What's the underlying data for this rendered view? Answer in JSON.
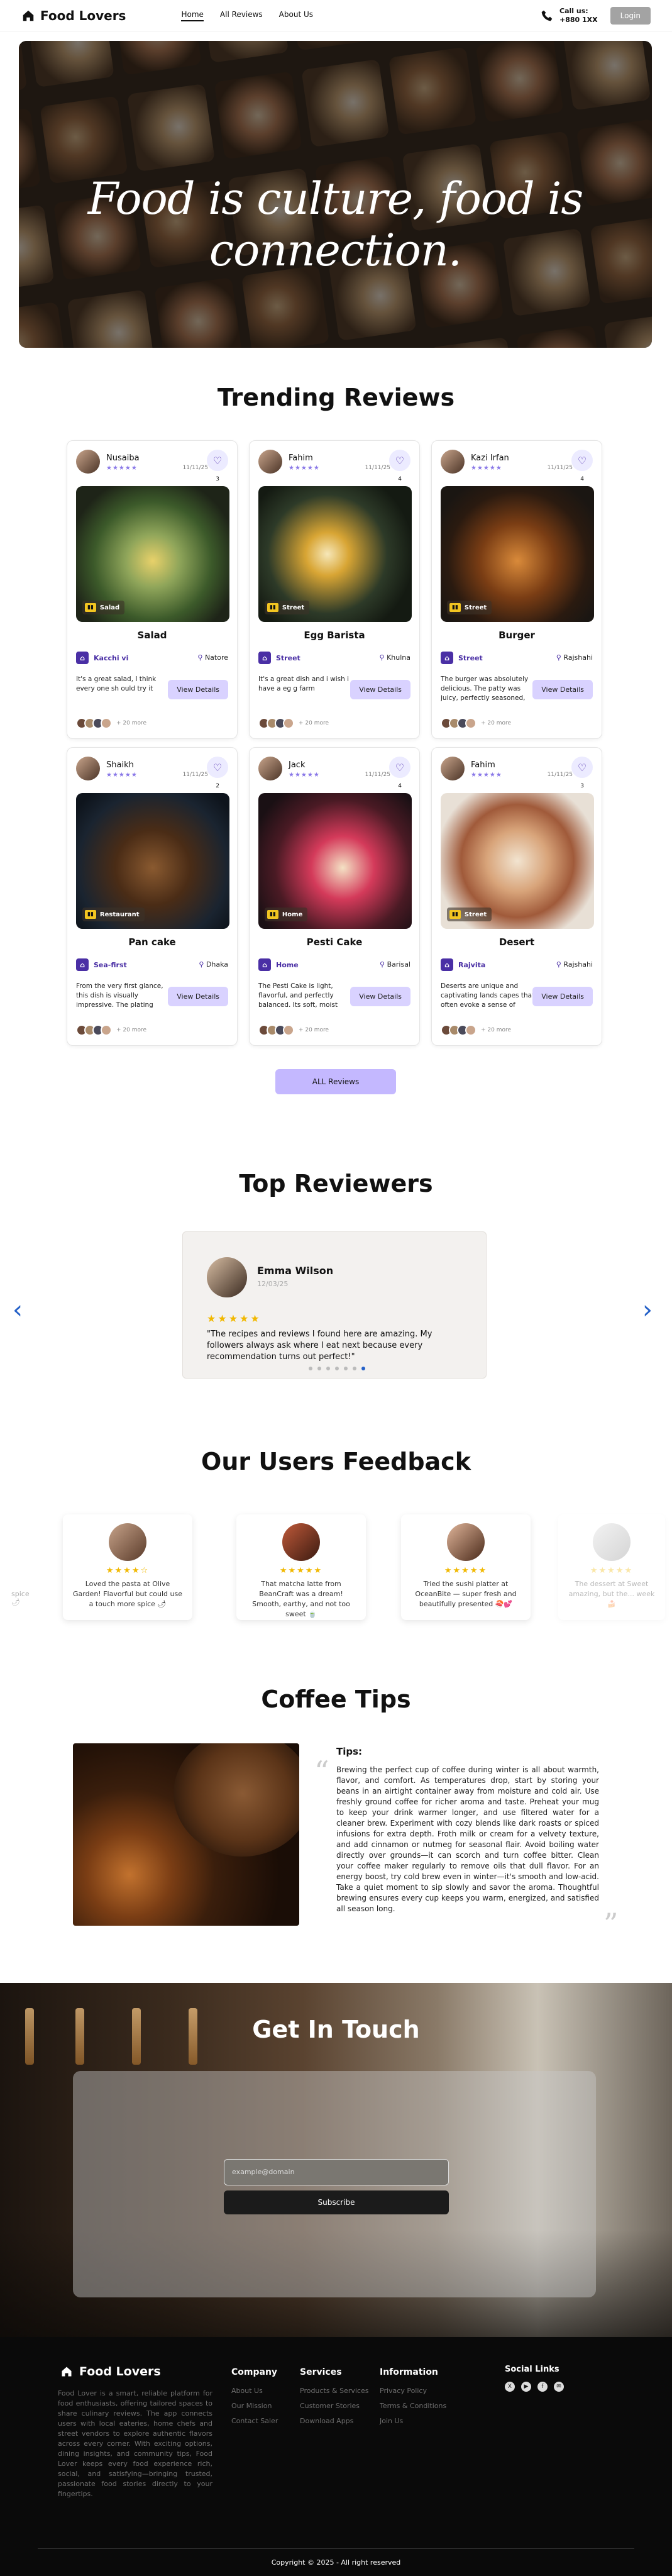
{
  "nav": {
    "brand": "Food Lovers",
    "links": [
      "Home",
      "All Reviews",
      "About Us"
    ],
    "call_label": "Call us:",
    "call_number": "+880 1XX",
    "login": "Login"
  },
  "hero": {
    "headline": "Food is culture, food is connection."
  },
  "trending": {
    "title": "Trending Reviews",
    "cards": [
      {
        "user": "Nusaiba",
        "date": "11/11/25",
        "likes": "3",
        "category": "Salad",
        "dish": "Salad",
        "restaurant": "Kacchi vi",
        "location": "Natore",
        "review": "It's a great salad, I think every one sh ould try it",
        "button": "View Details",
        "liked": "+ 20 more"
      },
      {
        "user": "Fahim",
        "date": "11/11/25",
        "likes": "4",
        "category": "Street",
        "dish": "Egg Barista",
        "restaurant": "Street",
        "location": "Khulna",
        "review": "It's a great dish and i wish i have a eg g farm",
        "button": "View Details",
        "liked": "+ 20 more"
      },
      {
        "user": "Kazi Irfan",
        "date": "11/11/25",
        "likes": "4",
        "category": "Street",
        "dish": "Burger",
        "restaurant": "Street",
        "location": "Rajshahi",
        "review": "The burger was absolutely delicious. The patty was juicy, perfectly seasoned, and cooked just...",
        "button": "View Details",
        "liked": "+ 20 more"
      },
      {
        "user": "Shaikh",
        "date": "11/11/25",
        "likes": "2",
        "category": "Restaurant",
        "dish": "Pan cake",
        "restaurant": "Sea-first",
        "location": "Dhaka",
        "review": "From the very first glance, this dish is visually impressive. The plating looks thoughtful an...",
        "button": "View Details",
        "liked": "+ 20 more"
      },
      {
        "user": "Jack",
        "date": "11/11/25",
        "likes": "4",
        "category": "Home",
        "dish": "Pesti Cake",
        "restaurant": "Home",
        "location": "Barisal",
        "review": "The Pesti Cake is light, flavorful, and perfectly balanced. Its soft, moist texture pairs...",
        "button": "View Details",
        "liked": "+ 20 more"
      },
      {
        "user": "Fahim",
        "date": "11/11/25",
        "likes": "3",
        "category": "Street",
        "dish": "Desert",
        "restaurant": "Rajvita",
        "location": "Rajshahi",
        "review": "Deserts are unique and captivating lands capes that often evoke a sense of solitude and...",
        "button": "View Details",
        "liked": "+ 20 more"
      }
    ],
    "all_button": "ALL Reviews"
  },
  "top_reviewers": {
    "title": "Top Reviewers",
    "name": "Emma Wilson",
    "date": "12/03/25",
    "stars": "★★★★★",
    "quote": "\"The recipes and reviews I found here are amazing. My followers always ask where I eat next because every recommendation turns out perfect!\""
  },
  "feedback": {
    "title": "Our Users Feedback",
    "items": [
      {
        "stars": "★★★★☆",
        "text": "Loved the pasta at Olive Garden! Flavorful but could use a touch more spice 🌶"
      },
      {
        "stars": "★★★★★",
        "text": "That matcha latte from BeanCraft was a dream! Smooth, earthy, and not too sweet 🍵"
      },
      {
        "stars": "★★★★★",
        "text": "Tried the sushi platter at OceanBite — super fresh and beautifully presented 🍣💕"
      },
      {
        "stars": "★★★★★",
        "text": "The dessert at Sweet amazing, but the... week 🍰"
      }
    ],
    "left_fade": "spice 🌶"
  },
  "coffee": {
    "title": "Coffee Tips",
    "heading": "Tips:",
    "text": "Brewing the perfect cup of coffee during winter is all about warmth, flavor, and comfort. As temperatures drop, start by storing your beans in an airtight container away from moisture and cold air. Use freshly ground coffee for richer aroma and taste. Preheat your mug to keep your drink warmer longer, and use filtered water for a cleaner brew. Experiment with cozy blends like dark roasts or spiced infusions for extra depth. Froth milk or cream for a velvety texture, and add cinnamon or nutmeg for seasonal flair. Avoid boiling water directly over grounds—it can scorch and turn coffee bitter. Clean your coffee maker regularly to remove oils that dull flavor. For an energy boost, try cold brew even in winter—it's smooth and low-acid. Take a quiet moment to sip slowly and savor the aroma. Thoughtful brewing ensures every cup keeps you warm, energized, and satisfied all season long."
  },
  "contact": {
    "title": "Get In Touch",
    "placeholder": "example@domain",
    "button": "Subscribe"
  },
  "footer": {
    "brand": "Food Lovers",
    "desc": "Food Lover is a smart, reliable platform for food enthusiasts, offering tailored spaces to share culinary reviews. The app connects users with local eateries, home chefs and street vendors to explore authentic flavors across every corner. With exciting options, dining insights, and community tips, Food Lover keeps every food experience rich, social, and satisfying—bringing trusted, passionate food stories directly to your fingertips.",
    "company": {
      "title": "Company",
      "items": [
        "About Us",
        "Our Mission",
        "Contact Saler"
      ]
    },
    "services": {
      "title": "Services",
      "items": [
        "Products & Services",
        "Customer Stories",
        "Download Apps"
      ]
    },
    "information": {
      "title": "Information",
      "items": [
        "Privacy Policy",
        "Terms & Conditions",
        "Join Us"
      ]
    },
    "social": {
      "title": "Social Links"
    },
    "copyright": "Copyright © 2025 - All right reserved"
  }
}
